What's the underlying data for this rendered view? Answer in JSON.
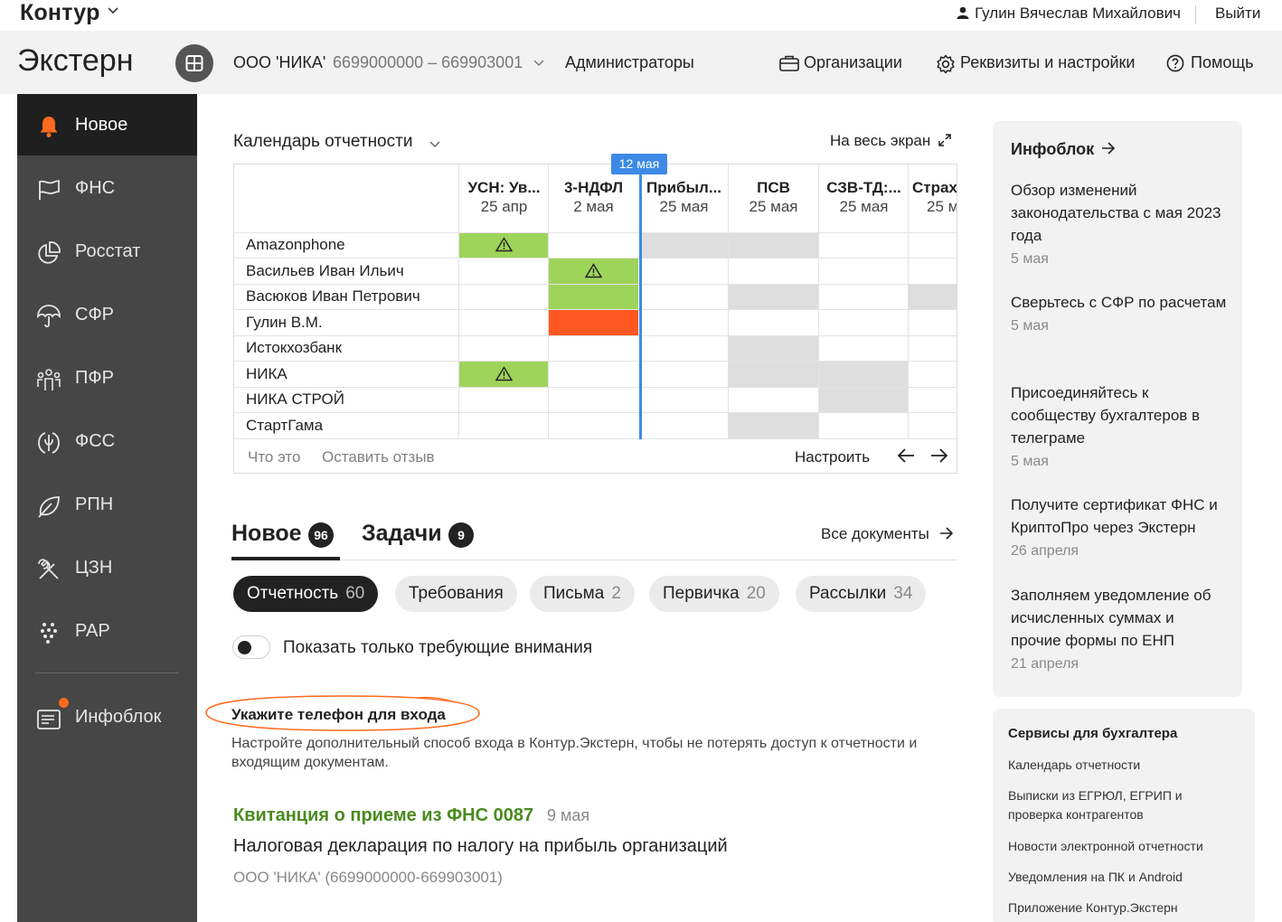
{
  "topbar": {
    "logo": "Контур",
    "user_name": "Гулин Вячеслав Михайлович",
    "logout": "Выйти"
  },
  "header": {
    "product": "Экстерн",
    "org_name": "ООО 'НИКА'",
    "org_inn": "6699000000 – 669903001",
    "admins": "Администраторы",
    "links": [
      "Организации",
      "Реквизиты и настройки",
      "Помощь"
    ]
  },
  "sidebar": {
    "items": [
      {
        "label": "Новое",
        "icon": "bell-icon"
      },
      {
        "label": "ФНС",
        "icon": "flag-icon"
      },
      {
        "label": "Росстат",
        "icon": "pie-chart-icon"
      },
      {
        "label": "СФР",
        "icon": "umbrella-icon"
      },
      {
        "label": "ПФР",
        "icon": "people-icon"
      },
      {
        "label": "ФСС",
        "icon": "shield-icon"
      },
      {
        "label": "РПН",
        "icon": "leaf-icon"
      },
      {
        "label": "ЦЗН",
        "icon": "tools-icon"
      },
      {
        "label": "РАР",
        "icon": "grapes-icon"
      }
    ],
    "infoblock": "Инфоблок"
  },
  "calendar": {
    "title": "Календарь отчетности",
    "fullscreen": "На весь экран",
    "today": "12 мая",
    "columns": [
      {
        "name": "УСН: Ув...",
        "date": "25 апр"
      },
      {
        "name": "3-НДФЛ",
        "date": "2 мая"
      },
      {
        "name": "Прибыл...",
        "date": "25 мая"
      },
      {
        "name": "ПСВ",
        "date": "25 мая"
      },
      {
        "name": "СЗВ-ТД:...",
        "date": "25 мая"
      },
      {
        "name": "Страх",
        "date": "25 м"
      }
    ],
    "rows": [
      "Amazonphone",
      "Васильев Иван Ильич",
      "Васюков Иван Петрович",
      "Гулин В.М.",
      "Истокхозбанк",
      "НИКА",
      "НИКА СТРОЙ",
      "СтартГама"
    ],
    "footer": {
      "what": "Что это",
      "feedback": "Оставить отзыв",
      "setup": "Настроить"
    },
    "colors": {
      "green": "#9ed45a",
      "red": "#ff5722",
      "grey": "#dedede",
      "today": "#3d8ae6"
    }
  },
  "tabs": {
    "new_label": "Новое",
    "new_count": "96",
    "tasks_label": "Задачи",
    "tasks_count": "9",
    "all_docs": "Все документы"
  },
  "filters": [
    {
      "label": "Отчетность",
      "count": "60"
    },
    {
      "label": "Требования",
      "count": ""
    },
    {
      "label": "Письма",
      "count": "2"
    },
    {
      "label": "Первичка",
      "count": "20"
    },
    {
      "label": "Рассылки",
      "count": "34"
    }
  ],
  "toggle_label": "Показать только требующие внимания",
  "phone_notice": {
    "title": "Укажите телефон для входа",
    "text": "Настройте дополнительный способ входа в Контур.Экстерн, чтобы не потерять доступ к отчетности и входящим документам."
  },
  "document": {
    "title": "Квитанция о приеме из ФНС 0087",
    "date": "9 мая",
    "subtitle": "Налоговая декларация по налогу на прибыль организаций",
    "org": "ООО 'НИКА' (6699000000-669903001)"
  },
  "infoblock": {
    "title": "Инфоблок",
    "news": [
      {
        "title": "Обзор изменений законодательства с мая 2023 года",
        "date": "5 мая"
      },
      {
        "title": "Сверьтесь с СФР по расчетам",
        "date": "5 мая"
      },
      {
        "title": "Присоединяйтесь к сообществу бухгалтеров в телеграме",
        "date": "5 мая"
      },
      {
        "title": "Получите сертификат ФНС и КриптоПро через Экстерн",
        "date": "26 апреля"
      },
      {
        "title": "Заполняем уведомление об исчисленных суммах и прочие формы по ЕНП",
        "date": "21 апреля"
      }
    ]
  },
  "services": {
    "title": "Сервисы для бухгалтера",
    "items": [
      "Календарь отчетности",
      "Выписки из ЕГРЮЛ, ЕГРИП и проверка контрагентов",
      "Новости электронной отчетности",
      "Уведомления на ПК и Android",
      "Приложение Контур.Экстерн"
    ]
  }
}
